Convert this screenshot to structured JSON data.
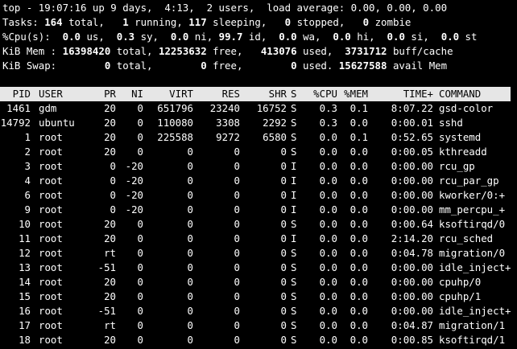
{
  "summary": {
    "uptime": "top - 19:07:16 up 9 days,  4:13,  2 users,  load average: 0.00, 0.00, 0.00",
    "tasks_label": "Tasks: ",
    "tasks_total": "164",
    "tasks_total_label": " total,   ",
    "tasks_running": "1",
    "tasks_running_label": " running, ",
    "tasks_sleeping": "117",
    "tasks_sleeping_label": " sleeping,   ",
    "tasks_stopped": "0",
    "tasks_stopped_label": " stopped,   ",
    "tasks_zombie": "0",
    "tasks_zombie_label": " zombie",
    "cpu_label": "%Cpu(s):  ",
    "cpu_us": "0.0",
    "cpu_us_label": " us,  ",
    "cpu_sy": "0.3",
    "cpu_sy_label": " sy,  ",
    "cpu_ni": "0.0",
    "cpu_ni_label": " ni, ",
    "cpu_id": "99.7",
    "cpu_id_label": " id,  ",
    "cpu_wa": "0.0",
    "cpu_wa_label": " wa,  ",
    "cpu_hi": "0.0",
    "cpu_hi_label": " hi,  ",
    "cpu_si": "0.0",
    "cpu_si_label": " si,  ",
    "cpu_st": "0.0",
    "cpu_st_label": " st",
    "mem_label": "KiB Mem : ",
    "mem_total": "16398420",
    "mem_total_label": " total, ",
    "mem_free": "12253632",
    "mem_free_label": " free,   ",
    "mem_used": "413076",
    "mem_used_label": " used,  ",
    "mem_buff": "3731712",
    "mem_buff_label": " buff/cache",
    "swap_label": "KiB Swap:        ",
    "swap_total": "0",
    "swap_total_label": " total,        ",
    "swap_free": "0",
    "swap_free_label": " free,        ",
    "swap_used": "0",
    "swap_used_label": " used. ",
    "swap_avail": "15627588",
    "swap_avail_label": " avail Mem"
  },
  "table": {
    "headers": [
      "PID",
      "USER",
      "PR",
      "NI",
      "VIRT",
      "RES",
      "SHR",
      "S",
      "%CPU",
      "%MEM",
      "TIME+",
      "COMMAND"
    ],
    "rows": [
      [
        "1461",
        "gdm",
        "20",
        "0",
        "651796",
        "23240",
        "16752",
        "S",
        "0.3",
        "0.1",
        "8:07.22",
        "gsd-color"
      ],
      [
        "14792",
        "ubuntu",
        "20",
        "0",
        "110080",
        "3308",
        "2292",
        "S",
        "0.3",
        "0.0",
        "0:00.01",
        "sshd"
      ],
      [
        "1",
        "root",
        "20",
        "0",
        "225588",
        "9272",
        "6580",
        "S",
        "0.0",
        "0.1",
        "0:52.65",
        "systemd"
      ],
      [
        "2",
        "root",
        "20",
        "0",
        "0",
        "0",
        "0",
        "S",
        "0.0",
        "0.0",
        "0:00.05",
        "kthreadd"
      ],
      [
        "3",
        "root",
        "0",
        "-20",
        "0",
        "0",
        "0",
        "I",
        "0.0",
        "0.0",
        "0:00.00",
        "rcu_gp"
      ],
      [
        "4",
        "root",
        "0",
        "-20",
        "0",
        "0",
        "0",
        "I",
        "0.0",
        "0.0",
        "0:00.00",
        "rcu_par_gp"
      ],
      [
        "6",
        "root",
        "0",
        "-20",
        "0",
        "0",
        "0",
        "I",
        "0.0",
        "0.0",
        "0:00.00",
        "kworker/0:+"
      ],
      [
        "9",
        "root",
        "0",
        "-20",
        "0",
        "0",
        "0",
        "I",
        "0.0",
        "0.0",
        "0:00.00",
        "mm_percpu_+"
      ],
      [
        "10",
        "root",
        "20",
        "0",
        "0",
        "0",
        "0",
        "S",
        "0.0",
        "0.0",
        "0:00.64",
        "ksoftirqd/0"
      ],
      [
        "11",
        "root",
        "20",
        "0",
        "0",
        "0",
        "0",
        "I",
        "0.0",
        "0.0",
        "2:14.20",
        "rcu_sched"
      ],
      [
        "12",
        "root",
        "rt",
        "0",
        "0",
        "0",
        "0",
        "S",
        "0.0",
        "0.0",
        "0:04.78",
        "migration/0"
      ],
      [
        "13",
        "root",
        "-51",
        "0",
        "0",
        "0",
        "0",
        "S",
        "0.0",
        "0.0",
        "0:00.00",
        "idle_inject+"
      ],
      [
        "14",
        "root",
        "20",
        "0",
        "0",
        "0",
        "0",
        "S",
        "0.0",
        "0.0",
        "0:00.00",
        "cpuhp/0"
      ],
      [
        "15",
        "root",
        "20",
        "0",
        "0",
        "0",
        "0",
        "S",
        "0.0",
        "0.0",
        "0:00.00",
        "cpuhp/1"
      ],
      [
        "16",
        "root",
        "-51",
        "0",
        "0",
        "0",
        "0",
        "S",
        "0.0",
        "0.0",
        "0:00.00",
        "idle_inject+"
      ],
      [
        "17",
        "root",
        "rt",
        "0",
        "0",
        "0",
        "0",
        "S",
        "0.0",
        "0.0",
        "0:04.87",
        "migration/1"
      ],
      [
        "18",
        "root",
        "20",
        "0",
        "0",
        "0",
        "0",
        "S",
        "0.0",
        "0.0",
        "0:00.85",
        "ksoftirqd/1"
      ]
    ]
  },
  "colors": {
    "background": "#000000",
    "foreground": "#ffffff",
    "header_bar": "#e6e6e6",
    "header_text": "#000000"
  }
}
